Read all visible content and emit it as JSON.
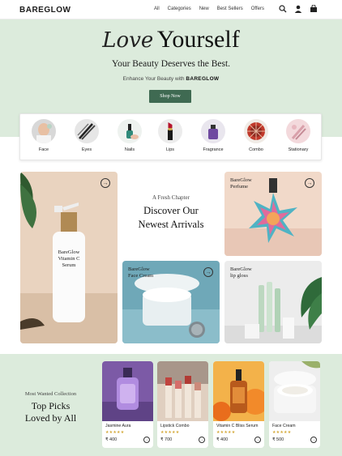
{
  "nav": {
    "logo": "BAREGLOW",
    "links": [
      "All",
      "Categories",
      "New",
      "Best Sellers",
      "Offers"
    ]
  },
  "hero": {
    "title_script": "Love",
    "title_main": "Yourself",
    "subtitle": "Your Beauty Deserves the Best.",
    "tagline_prefix": "Enhance Your Beauty with",
    "tagline_brand": "BAREGLOW",
    "cta": "Shop Now",
    "bg_color": "#dcebdc",
    "cta_color": "#3f6a52"
  },
  "categories": [
    {
      "label": "Face",
      "icon": "face-icon"
    },
    {
      "label": "Eyes",
      "icon": "eyes-icon"
    },
    {
      "label": "Nails",
      "icon": "nails-icon"
    },
    {
      "label": "Lips",
      "icon": "lips-icon"
    },
    {
      "label": "Fragrance",
      "icon": "fragrance-icon"
    },
    {
      "label": "Combo",
      "icon": "combo-icon"
    },
    {
      "label": "Stationary",
      "icon": "stationary-icon"
    }
  ],
  "featured": {
    "serum_caption": [
      "BareGlow",
      "Vitamin C",
      "Serum"
    ],
    "eyebrow": "A Fresh Chapter",
    "heading": [
      "Discover Our",
      "Newest Arrivals"
    ],
    "perfume_caption": [
      "BareGlow",
      "Perfume"
    ],
    "cream_caption": [
      "BareGlow",
      "Face Cream"
    ],
    "gloss_caption": [
      "BareGlow",
      "lip gloss"
    ]
  },
  "picks": {
    "eyebrow": "Most Wanted Collection",
    "heading": [
      "Top Picks",
      "Loved by All"
    ],
    "products": [
      {
        "name": "Jasmine Aura",
        "stars": "★★★★★",
        "price": "₹ 400"
      },
      {
        "name": "Lipstick Combo",
        "stars": "★★★★★",
        "price": "₹ 700"
      },
      {
        "name": "Vitamin C Bliss Serum",
        "stars": "★★★★★",
        "price": "₹ 400"
      },
      {
        "name": "Face Cream",
        "stars": "★★★★★",
        "price": "₹ 500"
      }
    ]
  }
}
